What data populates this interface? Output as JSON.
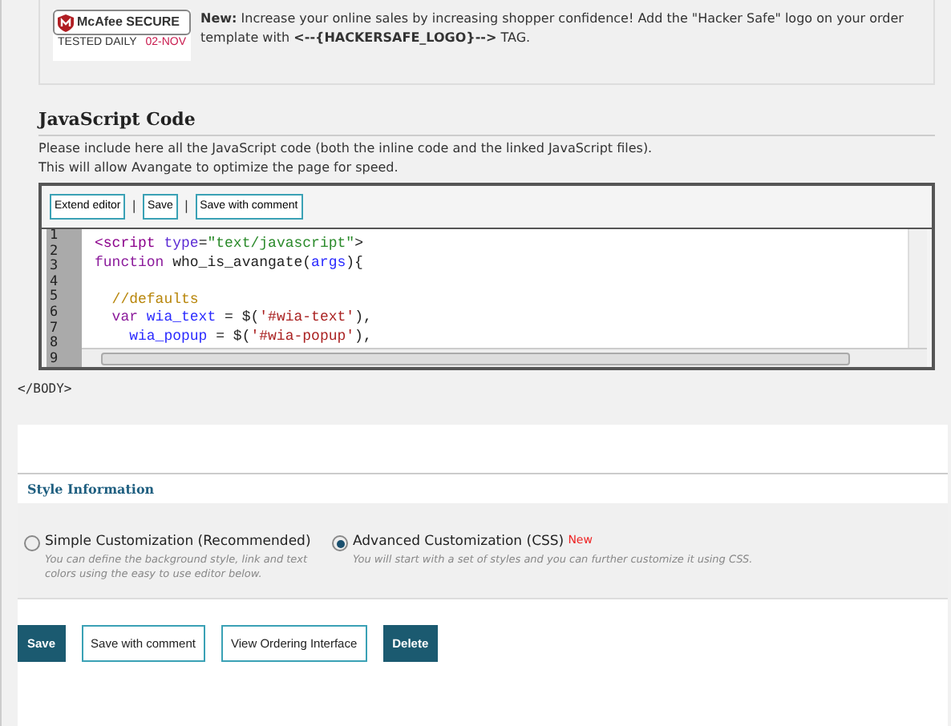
{
  "notice": {
    "badge": {
      "brand": "McAfee SECURE",
      "tested": "TESTED DAILY",
      "date": "02-NOV"
    },
    "text": "**New:** Increase your online sales by increasing shopper confidence! Add the \"Hacker Safe\" logo on your order template with **<--{HACKERSAFE_LOGO}-->** TAG."
  },
  "javascript_section": {
    "title": "JavaScript Code",
    "description": [
      "Please include here all the JavaScript code (both the inline code and the linked JavaScript files).",
      "This will allow Avangate to optimize the page for speed."
    ],
    "toolbar": [
      {
        "kind": "button",
        "text": "Extend editor"
      },
      {
        "kind": "separator",
        "text": "|"
      },
      {
        "kind": "button",
        "text": "Save"
      },
      {
        "kind": "separator",
        "text": "|"
      },
      {
        "kind": "button",
        "text": "Save with comment"
      }
    ],
    "line_numbers": [
      "1",
      "2",
      "3",
      "4",
      "5",
      "6",
      "7",
      "8",
      "9"
    ],
    "code_lines": [
      {
        "kind": "code",
        "tokens": [
          {
            "kind": "tag",
            "text": "<script "
          },
          {
            "kind": "attr",
            "text": "type"
          },
          {
            "kind": "plain",
            "text": "="
          },
          {
            "kind": "string",
            "text": "\"text/javascript\""
          },
          {
            "kind": "plain",
            "text": ">"
          }
        ]
      },
      {
        "kind": "code",
        "tokens": [
          {
            "kind": "keyword",
            "text": "function "
          },
          {
            "kind": "plain",
            "text": "who_is_avangate("
          },
          {
            "kind": "var",
            "text": "args"
          },
          {
            "kind": "plain",
            "text": "){"
          }
        ]
      },
      {
        "kind": "blank"
      },
      {
        "kind": "code",
        "tokens": [
          {
            "kind": "comment",
            "text": "  //defaults"
          }
        ]
      },
      {
        "kind": "code",
        "tokens": [
          {
            "kind": "keyword",
            "text": "  var "
          },
          {
            "kind": "var",
            "text": "wia_text"
          },
          {
            "kind": "plain",
            "text": " = $("
          },
          {
            "kind": "str2",
            "text": "'#wia-text'"
          },
          {
            "kind": "plain",
            "text": "),"
          }
        ]
      },
      {
        "kind": "code",
        "tokens": [
          {
            "kind": "var",
            "text": "    wia_popup"
          },
          {
            "kind": "plain",
            "text": " = $("
          },
          {
            "kind": "str2",
            "text": "'#wia-popup'"
          },
          {
            "kind": "plain",
            "text": "),"
          }
        ]
      }
    ]
  },
  "body_close": "</BODY>",
  "style_section": {
    "title": "Style Information",
    "options": [
      {
        "label": "Simple Customization (Recommended)",
        "description": "You can define the background style, link and text colors using the easy to use editor below.",
        "selected": false
      },
      {
        "label": "Advanced Customization (CSS)",
        "badge": "New",
        "description": "You will start with a set of styles and you can further customize it using CSS.",
        "selected": true
      }
    ]
  },
  "buttons": [
    {
      "label": "Save",
      "kind": "primary"
    },
    {
      "label": "Save with comment",
      "kind": "secondary"
    },
    {
      "label": "View Ordering Interface",
      "kind": "secondary"
    },
    {
      "label": "Delete",
      "kind": "primary"
    }
  ]
}
